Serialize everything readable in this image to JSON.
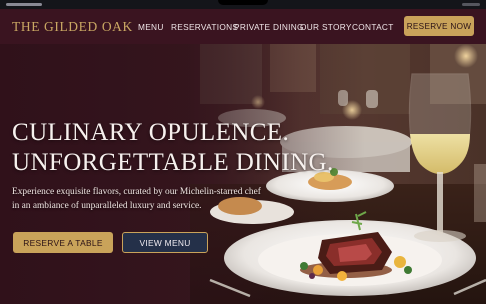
{
  "brand": {
    "name": "THE GILDED OAK"
  },
  "nav": {
    "items": [
      "MENU",
      "RESERVATIONS",
      "PRIVATE DINING",
      "OUR STORY",
      "CONTACT"
    ],
    "cta_label": "RESERVE NOW"
  },
  "hero": {
    "headline_line1": "CULINARY OPULENCE.",
    "headline_line2": "UNFORGETTABLE DINING.",
    "subtext_line1": "Experience exquisite flavors, curated by our Michelin-starred chef",
    "subtext_line2": "in an ambiance of unparalleled luxury and service.",
    "primary_button": "RESERVE A TABLE",
    "secondary_button": "VIEW MENU"
  },
  "colors": {
    "accent_gold": "#c9a35a",
    "nav_background": "#3a1420",
    "secondary_button": "#243049"
  },
  "icons": [
    "steak-dish-image",
    "wine-glass-image",
    "dining-room-background"
  ]
}
